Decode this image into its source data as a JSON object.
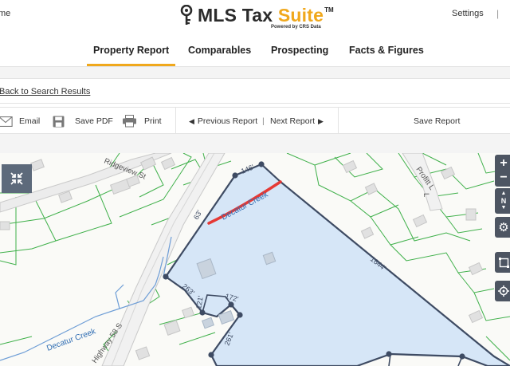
{
  "header": {
    "left_text": "me",
    "logo": {
      "word1": "MLS Tax ",
      "word2": "Suite",
      "tm": "TM",
      "subtitle": "Powered by CRS Data"
    },
    "settings_label": "Settings",
    "separator": "|"
  },
  "nav": {
    "tabs": [
      {
        "label": "Property Report",
        "active": true
      },
      {
        "label": "Comparables",
        "active": false
      },
      {
        "label": "Prospecting",
        "active": false
      },
      {
        "label": "Facts & Figures",
        "active": false
      }
    ]
  },
  "back_link": "Back to Search Results",
  "toolbar": {
    "email_label": "Email",
    "save_pdf_label": "Save PDF",
    "print_label": "Print",
    "previous_label": "Previous Report",
    "next_label": "Next Report",
    "nav_separator": "|",
    "save_report_label": "Save Report"
  },
  "map": {
    "street_labels": {
      "ridgeview": "Ridgeview St",
      "highway": "Highway 58 S",
      "profitt": "Profitt L",
      "profitt2": "L"
    },
    "creek_labels": {
      "upper": "Decatur Creek",
      "lower": "Decatur Creek"
    },
    "dimension_labels": {
      "top": "146'",
      "left_upper": "63'",
      "right_long": "1644'",
      "left_mid": "263'",
      "inner1": "121'",
      "inner2": "172'",
      "inner3": "261'"
    },
    "north_label": "N",
    "colors": {
      "parcel_fill": "#d6e6f7",
      "parcel_stroke": "#3e4b63",
      "lot_lines": "#3fb04a",
      "creek_highlight": "#e53935",
      "water": "#4f89c9",
      "control_bg": "#4d5562",
      "accent": "#f0a81c"
    }
  }
}
